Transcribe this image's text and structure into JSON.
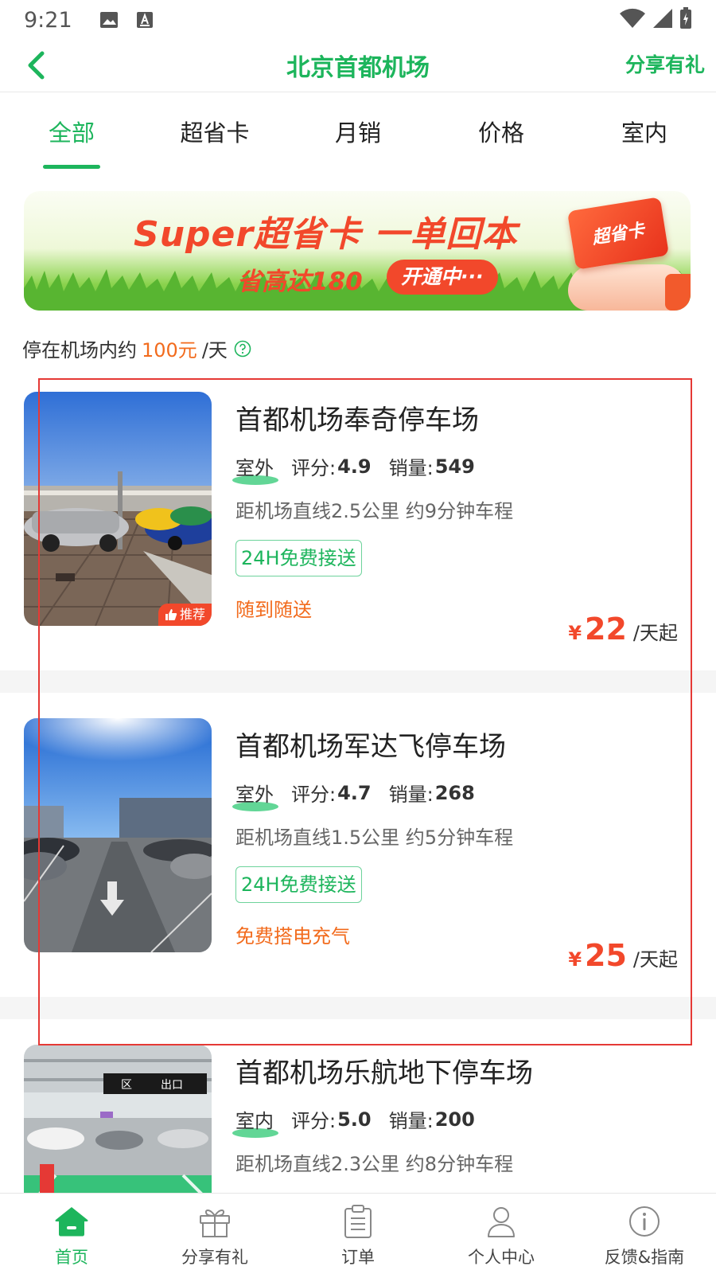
{
  "status_bar": {
    "time": "9:21"
  },
  "header": {
    "title": "北京首都机场",
    "share": "分享有礼"
  },
  "tabs": [
    {
      "label": "全部",
      "active": true
    },
    {
      "label": "超省卡",
      "active": false
    },
    {
      "label": "月销",
      "active": false
    },
    {
      "label": "价格",
      "active": false
    },
    {
      "label": "室内",
      "active": false
    }
  ],
  "banner": {
    "title": "Super超省卡 一单回本",
    "subtitle": "省高达180",
    "button": "开通中···",
    "card_label": "超省卡"
  },
  "price_hint": {
    "prefix": "停在机场内约",
    "amount": "100元",
    "suffix": "/天"
  },
  "lots": [
    {
      "name": "首都机场奉奇停车场",
      "type": "室外",
      "rating_label": "评分:",
      "rating": "4.9",
      "sales_label": "销量:",
      "sales": "549",
      "distance": "距机场直线2.5公里 约9分钟车程",
      "service": "24H免费接送",
      "perk": "随到随送",
      "price_symbol": "¥",
      "price": "22",
      "price_unit": "/天起",
      "badge": "推荐"
    },
    {
      "name": "首都机场军达飞停车场",
      "type": "室外",
      "rating_label": "评分:",
      "rating": "4.7",
      "sales_label": "销量:",
      "sales": "268",
      "distance": "距机场直线1.5公里 约5分钟车程",
      "service": "24H免费接送",
      "perk": "免费搭电充气",
      "price_symbol": "¥",
      "price": "25",
      "price_unit": "/天起"
    },
    {
      "name": "首都机场乐航地下停车场",
      "type": "室内",
      "rating_label": "评分:",
      "rating": "5.0",
      "sales_label": "销量:",
      "sales": "200",
      "distance": "距机场直线2.3公里 约8分钟车程",
      "sign_zone": "区",
      "sign_exit": "出口"
    }
  ],
  "bottom_nav": [
    {
      "label": "首页",
      "icon": "home-icon",
      "active": true
    },
    {
      "label": "分享有礼",
      "icon": "gift-icon",
      "active": false
    },
    {
      "label": "订单",
      "icon": "clipboard-icon",
      "active": false
    },
    {
      "label": "个人中心",
      "icon": "user-icon",
      "active": false
    },
    {
      "label": "反馈&指南",
      "icon": "info-icon",
      "active": false
    }
  ],
  "colors": {
    "accent": "#1db55c",
    "price": "#f2482b",
    "highlight": "#e53935"
  }
}
